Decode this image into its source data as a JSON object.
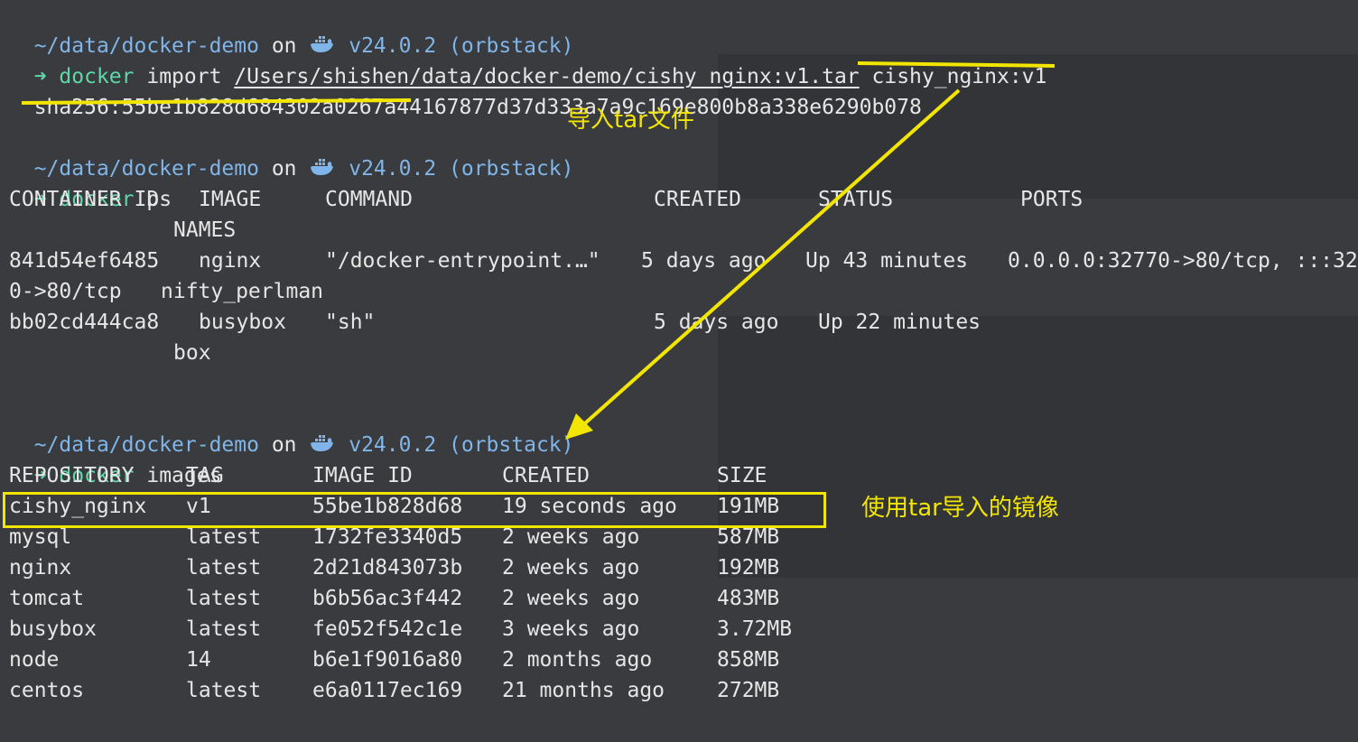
{
  "prompt": {
    "path": "~/data/docker-demo",
    "on": "on",
    "version": "v24.0.2 (orbstack)",
    "arrow": "➜"
  },
  "cmd1": {
    "docker": "docker",
    "args_pre": " import ",
    "tarpath": "/Users/shishen/data/docker-demo/cishy_nginx:v1.tar",
    "image": "cishy_nginx:v1",
    "output": "sha256:55be1b828d684302a0267a44167877d37d333a7a9c169e800b8a338e6290b078"
  },
  "cmd2": {
    "docker": "docker",
    "args": " ps",
    "headers": {
      "container_id": "CONTAINER ID",
      "image": "IMAGE",
      "command": "COMMAND",
      "created": "CREATED",
      "status": "STATUS",
      "ports": "PORTS",
      "names": "NAMES"
    },
    "rows": [
      {
        "container_id": "841d54ef6485",
        "image": "nginx",
        "command": "\"/docker-entrypoint.…\"",
        "created": "5 days ago",
        "status": "Up 43 minutes",
        "ports": "0.0.0.0:32770->80/tcp, :::32",
        "wrap": "0->80/tcp",
        "names": "nifty_perlman"
      },
      {
        "container_id": "bb02cd444ca8",
        "image": "busybox",
        "command": "\"sh\"",
        "created": "5 days ago",
        "status": "Up 22 minutes",
        "ports": "",
        "wrap": "",
        "names": "box"
      }
    ]
  },
  "cmd3": {
    "docker": "docker",
    "args": " images",
    "headers": {
      "repository": "REPOSITORY",
      "tag": "TAG",
      "image_id": "IMAGE ID",
      "created": "CREATED",
      "size": "SIZE"
    },
    "rows": [
      {
        "repository": "cishy_nginx",
        "tag": "v1",
        "image_id": "55be1b828d68",
        "created": "19 seconds ago",
        "size": "191MB"
      },
      {
        "repository": "mysql",
        "tag": "latest",
        "image_id": "1732fe3340d5",
        "created": "2 weeks ago",
        "size": "587MB"
      },
      {
        "repository": "nginx",
        "tag": "latest",
        "image_id": "2d21d843073b",
        "created": "2 weeks ago",
        "size": "192MB"
      },
      {
        "repository": "tomcat",
        "tag": "latest",
        "image_id": "b6b56ac3f442",
        "created": "2 weeks ago",
        "size": "483MB"
      },
      {
        "repository": "busybox",
        "tag": "latest",
        "image_id": "fe052f542c1e",
        "created": "3 weeks ago",
        "size": "3.72MB"
      },
      {
        "repository": "node",
        "tag": "14",
        "image_id": "b6e1f9016a80",
        "created": "2 months ago",
        "size": "858MB"
      },
      {
        "repository": "centos",
        "tag": "latest",
        "image_id": "e6a0117ec169",
        "created": "21 months ago",
        "size": "272MB"
      }
    ]
  },
  "annotations": {
    "import_note": "导入tar文件",
    "image_note": "使用tar导入的镜像",
    "color": "#f2e600"
  },
  "icons": {
    "docker": "docker-whale-icon"
  }
}
